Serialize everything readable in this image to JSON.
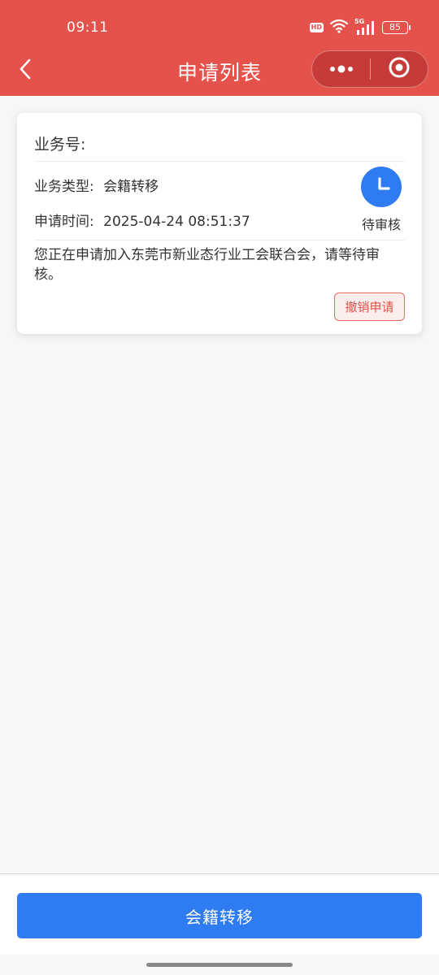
{
  "status_bar": {
    "time": "09:11",
    "hd_label": "HD",
    "network_label": "5G",
    "battery": "85",
    "icons": [
      "hd-icon",
      "wifi-icon",
      "signal-icon",
      "battery-icon"
    ]
  },
  "nav": {
    "title": "申请列表",
    "back_icon": "chevron-left-icon",
    "more_icon": "more-dots-icon",
    "close_icon": "target-close-icon"
  },
  "card": {
    "biz_no_label": "业务号:",
    "type_label": "业务类型:",
    "type_value": "会籍转移",
    "time_label": "申请时间:",
    "time_value": "2025-04-24 08:51:37",
    "status_icon": "clock-icon",
    "status_text": "待审核",
    "notice": "您正在申请加入东莞市新业态行业工会联合会，请等待审核。",
    "cancel_label": "撤销申请"
  },
  "bottom": {
    "primary_label": "会籍转移"
  },
  "colors": {
    "header_red": "#e5514b",
    "primary_blue": "#2f7bf2",
    "cancel_red": "#e5514b",
    "background": "#f7f7f7"
  }
}
